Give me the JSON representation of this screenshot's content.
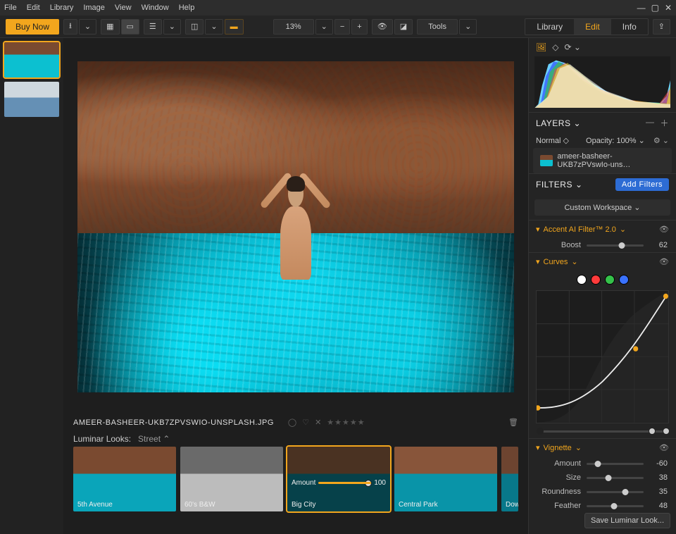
{
  "menu": {
    "file": "File",
    "edit": "Edit",
    "library": "Library",
    "image": "Image",
    "view": "View",
    "window": "Window",
    "help": "Help"
  },
  "toolbar": {
    "buy": "Buy Now",
    "zoom": "13%",
    "tools": "Tools"
  },
  "tabs": {
    "library": "Library",
    "edit": "Edit",
    "info": "Info"
  },
  "file": {
    "name": "AMEER-BASHEER-UKB7ZPVSWIO-UNSPLASH.JPG"
  },
  "looks": {
    "label": "Luminar Looks:",
    "category": "Street",
    "amount_label": "Amount",
    "amount_value": "100",
    "items": [
      "5th Avenue",
      "60's B&W",
      "Big City",
      "Central Park",
      "Downt"
    ]
  },
  "layers": {
    "title": "LAYERS",
    "blend": "Normal",
    "opacity_label": "Opacity:",
    "opacity": "100%",
    "name": "ameer-basheer-UKB7zPVswIo-uns…"
  },
  "filters": {
    "title": "FILTERS",
    "add": "Add Filters",
    "workspace": "Custom Workspace"
  },
  "accent": {
    "name": "Accent AI Filter™ 2.0",
    "boost_label": "Boost",
    "boost": 62
  },
  "curves": {
    "name": "Curves"
  },
  "vignette": {
    "name": "Vignette",
    "amount_label": "Amount",
    "amount": -60,
    "size_label": "Size",
    "size": 38,
    "roundness_label": "Roundness",
    "roundness": 35,
    "feather_label": "Feather",
    "feather": 48
  },
  "save": {
    "label": "Save Luminar Look..."
  },
  "chart_data": {
    "type": "line",
    "title": "Curves",
    "xlabel": "",
    "ylabel": "",
    "xlim": [
      0,
      255
    ],
    "ylim": [
      0,
      255
    ],
    "series": [
      {
        "name": "RGB",
        "x": [
          0,
          60,
          190,
          255
        ],
        "y": [
          30,
          35,
          120,
          252
        ]
      }
    ]
  }
}
